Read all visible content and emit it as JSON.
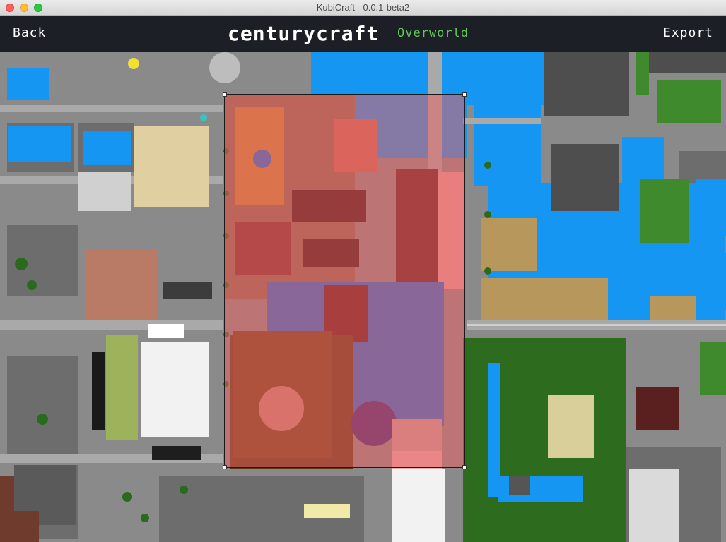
{
  "window": {
    "title": "KubiCraft - 0.0.1-beta2"
  },
  "toolbar": {
    "back_label": "Back",
    "world_name": "centurycraft",
    "dimension": "Overworld",
    "export_label": "Export"
  },
  "colors": {
    "toolbar_bg": "#1c1f26",
    "dimension_text": "#63c75a",
    "selection_fill": "#eb5f5f",
    "water": "#1596f2",
    "road": "#8a8a8a",
    "grass": "#3e8a2c"
  }
}
